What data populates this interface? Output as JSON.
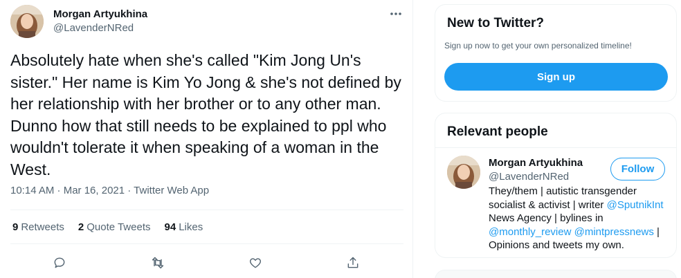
{
  "tweet": {
    "author_name": "Morgan Artyukhina",
    "author_handle": "@LavenderNRed",
    "text": "Absolutely hate when she's called \"Kim Jong Un's sister.\" Her name is Kim Yo Jong & she's not defined by her relationship with her brother or to any other man. Dunno how that still needs to be explained to ppl who wouldn't tolerate it when speaking of a woman in the West.",
    "time": "10:14 AM · Mar 16, 2021 · ",
    "source": "Twitter Web App",
    "stats": [
      {
        "count": "9",
        "label": "Retweets"
      },
      {
        "count": "2",
        "label": "Quote Tweets"
      },
      {
        "count": "94",
        "label": "Likes"
      }
    ],
    "more_icon": "more-horizontal-icon",
    "action_icons": [
      "reply-icon",
      "retweet-icon",
      "like-icon",
      "share-icon"
    ]
  },
  "sidebar": {
    "new_to_twitter": {
      "heading": "New to Twitter?",
      "subtitle": "Sign up now to get your own personalized timeline!",
      "button": "Sign up"
    },
    "relevant_people": {
      "heading": "Relevant people",
      "person": {
        "name": "Morgan Artyukhina",
        "handle": "@LavenderNRed",
        "follow_label": "Follow",
        "bio_parts": [
          {
            "text": "They/them | autistic transgender socialist & activist | writer ",
            "link": false
          },
          {
            "text": "@SputnikInt",
            "link": true
          },
          {
            "text": " News Agency | bylines in ",
            "link": false
          },
          {
            "text": "@monthly_review",
            "link": true
          },
          {
            "text": " ",
            "link": false
          },
          {
            "text": "@mintpressnews",
            "link": true
          },
          {
            "text": " | Opinions and tweets my own.",
            "link": false
          }
        ]
      }
    }
  },
  "colors": {
    "accent": "#1d9bf0",
    "text_primary": "#0f1419",
    "text_secondary": "#536471"
  }
}
